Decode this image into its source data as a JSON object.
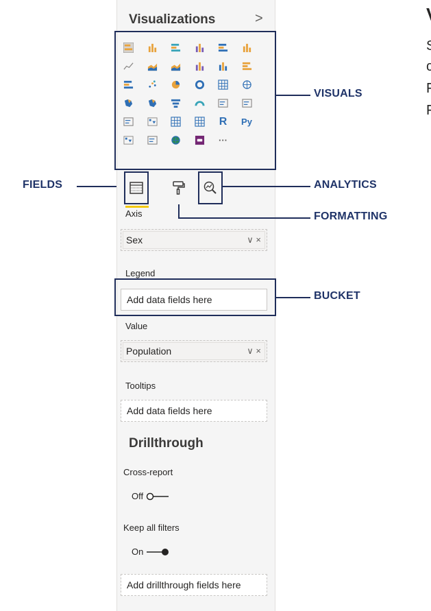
{
  "panel": {
    "title": "Visualizations",
    "chevron": ">"
  },
  "visual_icons": [
    {
      "name": "stacked-bar-icon"
    },
    {
      "name": "stacked-column-icon"
    },
    {
      "name": "clustered-bar-icon"
    },
    {
      "name": "clustered-column-icon"
    },
    {
      "name": "100pct-bar-icon"
    },
    {
      "name": "100pct-column-icon"
    },
    {
      "name": "line-chart-icon"
    },
    {
      "name": "area-chart-icon"
    },
    {
      "name": "stacked-area-icon"
    },
    {
      "name": "line-column-icon"
    },
    {
      "name": "line-clustered-column-icon"
    },
    {
      "name": "ribbon-chart-icon"
    },
    {
      "name": "waterfall-icon"
    },
    {
      "name": "scatter-icon"
    },
    {
      "name": "pie-icon"
    },
    {
      "name": "donut-icon"
    },
    {
      "name": "treemap-icon"
    },
    {
      "name": "map-icon"
    },
    {
      "name": "filled-map-icon"
    },
    {
      "name": "shape-map-icon"
    },
    {
      "name": "funnel-icon"
    },
    {
      "name": "gauge-icon"
    },
    {
      "name": "card-icon"
    },
    {
      "name": "multirow-card-icon"
    },
    {
      "name": "kpi-icon"
    },
    {
      "name": "slicer-icon"
    },
    {
      "name": "table-icon"
    },
    {
      "name": "matrix-icon"
    },
    {
      "name": "r-visual-icon",
      "text": "R"
    },
    {
      "name": "python-visual-icon",
      "text": "Py"
    },
    {
      "name": "key-influencers-icon"
    },
    {
      "name": "qa-icon"
    },
    {
      "name": "arcgis-icon"
    },
    {
      "name": "custom-visual-icon"
    },
    {
      "name": "more-visuals-icon",
      "text": "···"
    }
  ],
  "tabs": {
    "fields": {
      "icon": "fields-icon"
    },
    "format": {
      "icon": "format-paint-roller-icon"
    },
    "analytics": {
      "icon": "analytics-magnifier-icon"
    }
  },
  "wells": {
    "axis": {
      "label": "Axis",
      "value": "Sex",
      "actions": "∨ ×"
    },
    "legend": {
      "label": "Legend",
      "placeholder": "Add data fields here"
    },
    "value": {
      "label": "Value",
      "value": "Population",
      "actions": "∨ ×"
    },
    "tooltips": {
      "label": "Tooltips",
      "placeholder": "Add data fields here"
    }
  },
  "drillthrough": {
    "title": "Drillthrough",
    "cross_report": {
      "label": "Cross-report",
      "state": "Off"
    },
    "keep_filters": {
      "label": "Keep all filters",
      "state": "On"
    },
    "placeholder": "Add drillthrough fields here"
  },
  "callouts": {
    "visuals": "VISUALS",
    "fields": "FIELDS",
    "analytics": "ANALYTICS",
    "formatting": "FORMATTING",
    "bucket": "BUCKET"
  },
  "right_text": [
    "V",
    "S",
    "c",
    "F",
    "F"
  ],
  "colors": {
    "accent": "#1f2d5a",
    "callout_text": "#1f3368",
    "tab_underline": "#f2c811",
    "brand_purple": "#742774"
  }
}
